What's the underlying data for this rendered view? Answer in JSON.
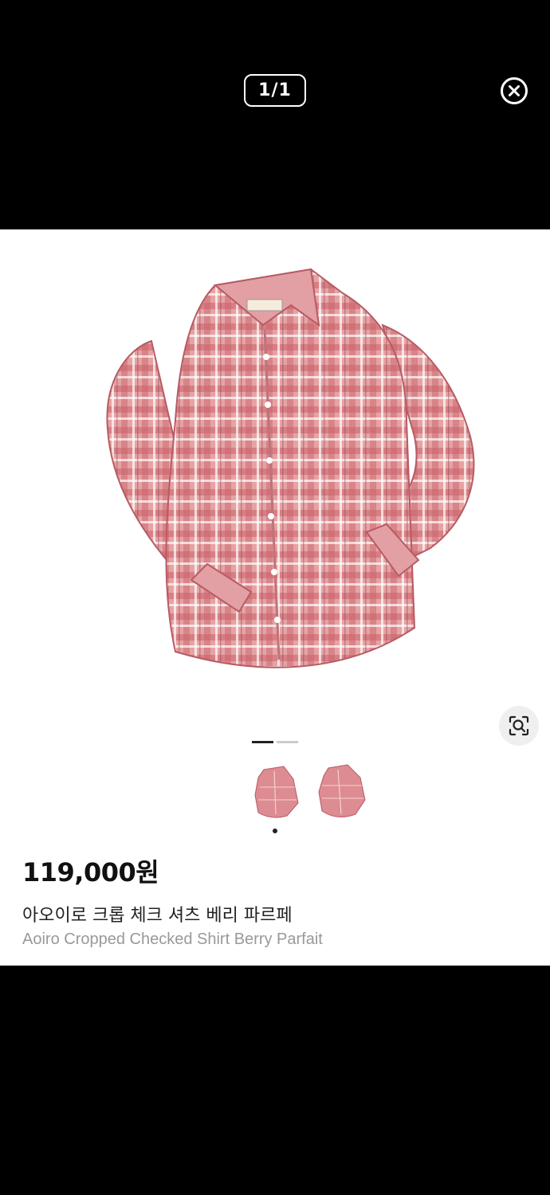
{
  "viewer": {
    "counter": "1/1",
    "close_icon": "close-circle-icon"
  },
  "product": {
    "image_icon": "checked-shirt-photo",
    "lens_icon": "visual-search-icon",
    "image_count": 2,
    "current_image": 1,
    "thumbnails": [
      "shirt-thumbnail-1",
      "shirt-thumbnail-2"
    ],
    "price": "119,000원",
    "name_ko": "아오이로 크롭 체크 셔츠 베리 파르페",
    "name_en": "Aoiro Cropped Checked Shirt Berry Parfait"
  },
  "colors": {
    "background": "#000000",
    "card": "#ffffff",
    "shirt": "#d9848a",
    "accent_text": "#111111",
    "muted_text": "#999999"
  }
}
